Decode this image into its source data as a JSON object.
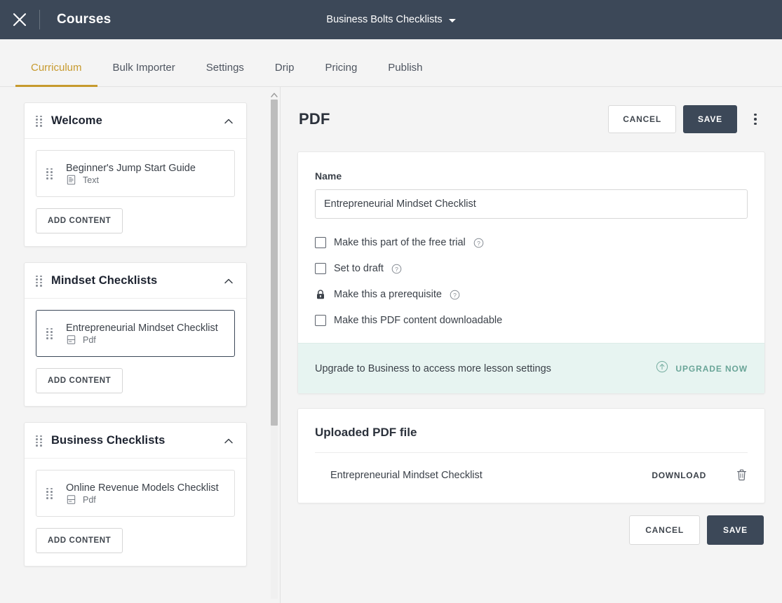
{
  "topbar": {
    "close_icon": "close-icon",
    "title": "Courses",
    "course_name": "Business Bolts Checklists"
  },
  "tabs": [
    {
      "label": "Curriculum",
      "active": true
    },
    {
      "label": "Bulk Importer",
      "active": false
    },
    {
      "label": "Settings",
      "active": false
    },
    {
      "label": "Drip",
      "active": false
    },
    {
      "label": "Pricing",
      "active": false
    },
    {
      "label": "Publish",
      "active": false
    }
  ],
  "sidebar": {
    "add_content_label": "ADD CONTENT",
    "sections": [
      {
        "title": "Welcome",
        "lesson": {
          "name": "Beginner's Jump Start Guide",
          "type": "Text",
          "type_icon": "text-file-icon",
          "selected": false
        }
      },
      {
        "title": "Mindset Checklists",
        "lesson": {
          "name": "Entrepreneurial Mindset Checklist",
          "type": "Pdf",
          "type_icon": "pdf-file-icon",
          "selected": true
        }
      },
      {
        "title": "Business Checklists",
        "lesson": {
          "name": "Online Revenue Models Checklist",
          "type": "Pdf",
          "type_icon": "pdf-file-icon",
          "selected": false
        }
      }
    ]
  },
  "main": {
    "title": "PDF",
    "cancel_label": "CANCEL",
    "save_label": "SAVE",
    "form": {
      "name_label": "Name",
      "name_value": "Entrepreneurial Mindset Checklist",
      "name_placeholder": "Name",
      "options": [
        {
          "label": "Make this part of the free trial",
          "control": "checkbox",
          "checked": false,
          "help": true
        },
        {
          "label": "Set to draft",
          "control": "checkbox",
          "checked": false,
          "help": true
        },
        {
          "label": "Make this a prerequisite",
          "control": "lock",
          "checked": false,
          "help": true
        },
        {
          "label": "Make this PDF content downloadable",
          "control": "checkbox",
          "checked": false,
          "help": false
        }
      ]
    },
    "upgrade": {
      "text": "Upgrade to Business to access more lesson settings",
      "link_label": "UPGRADE NOW",
      "icon": "arrow-up-circle-icon",
      "accent_color": "#6aa598",
      "background_color": "#e7f4f1"
    },
    "upload": {
      "title": "Uploaded PDF file",
      "file_name": "Entrepreneurial Mindset Checklist",
      "download_label": "DOWNLOAD",
      "delete_icon": "trash-icon"
    },
    "footer": {
      "cancel_label": "CANCEL",
      "save_label": "SAVE"
    }
  },
  "theme": {
    "topbar_bg": "#3c4858",
    "accent": "#c79a2e",
    "primary_button": "#3c4858",
    "page_bg": "#f4f4f4"
  }
}
